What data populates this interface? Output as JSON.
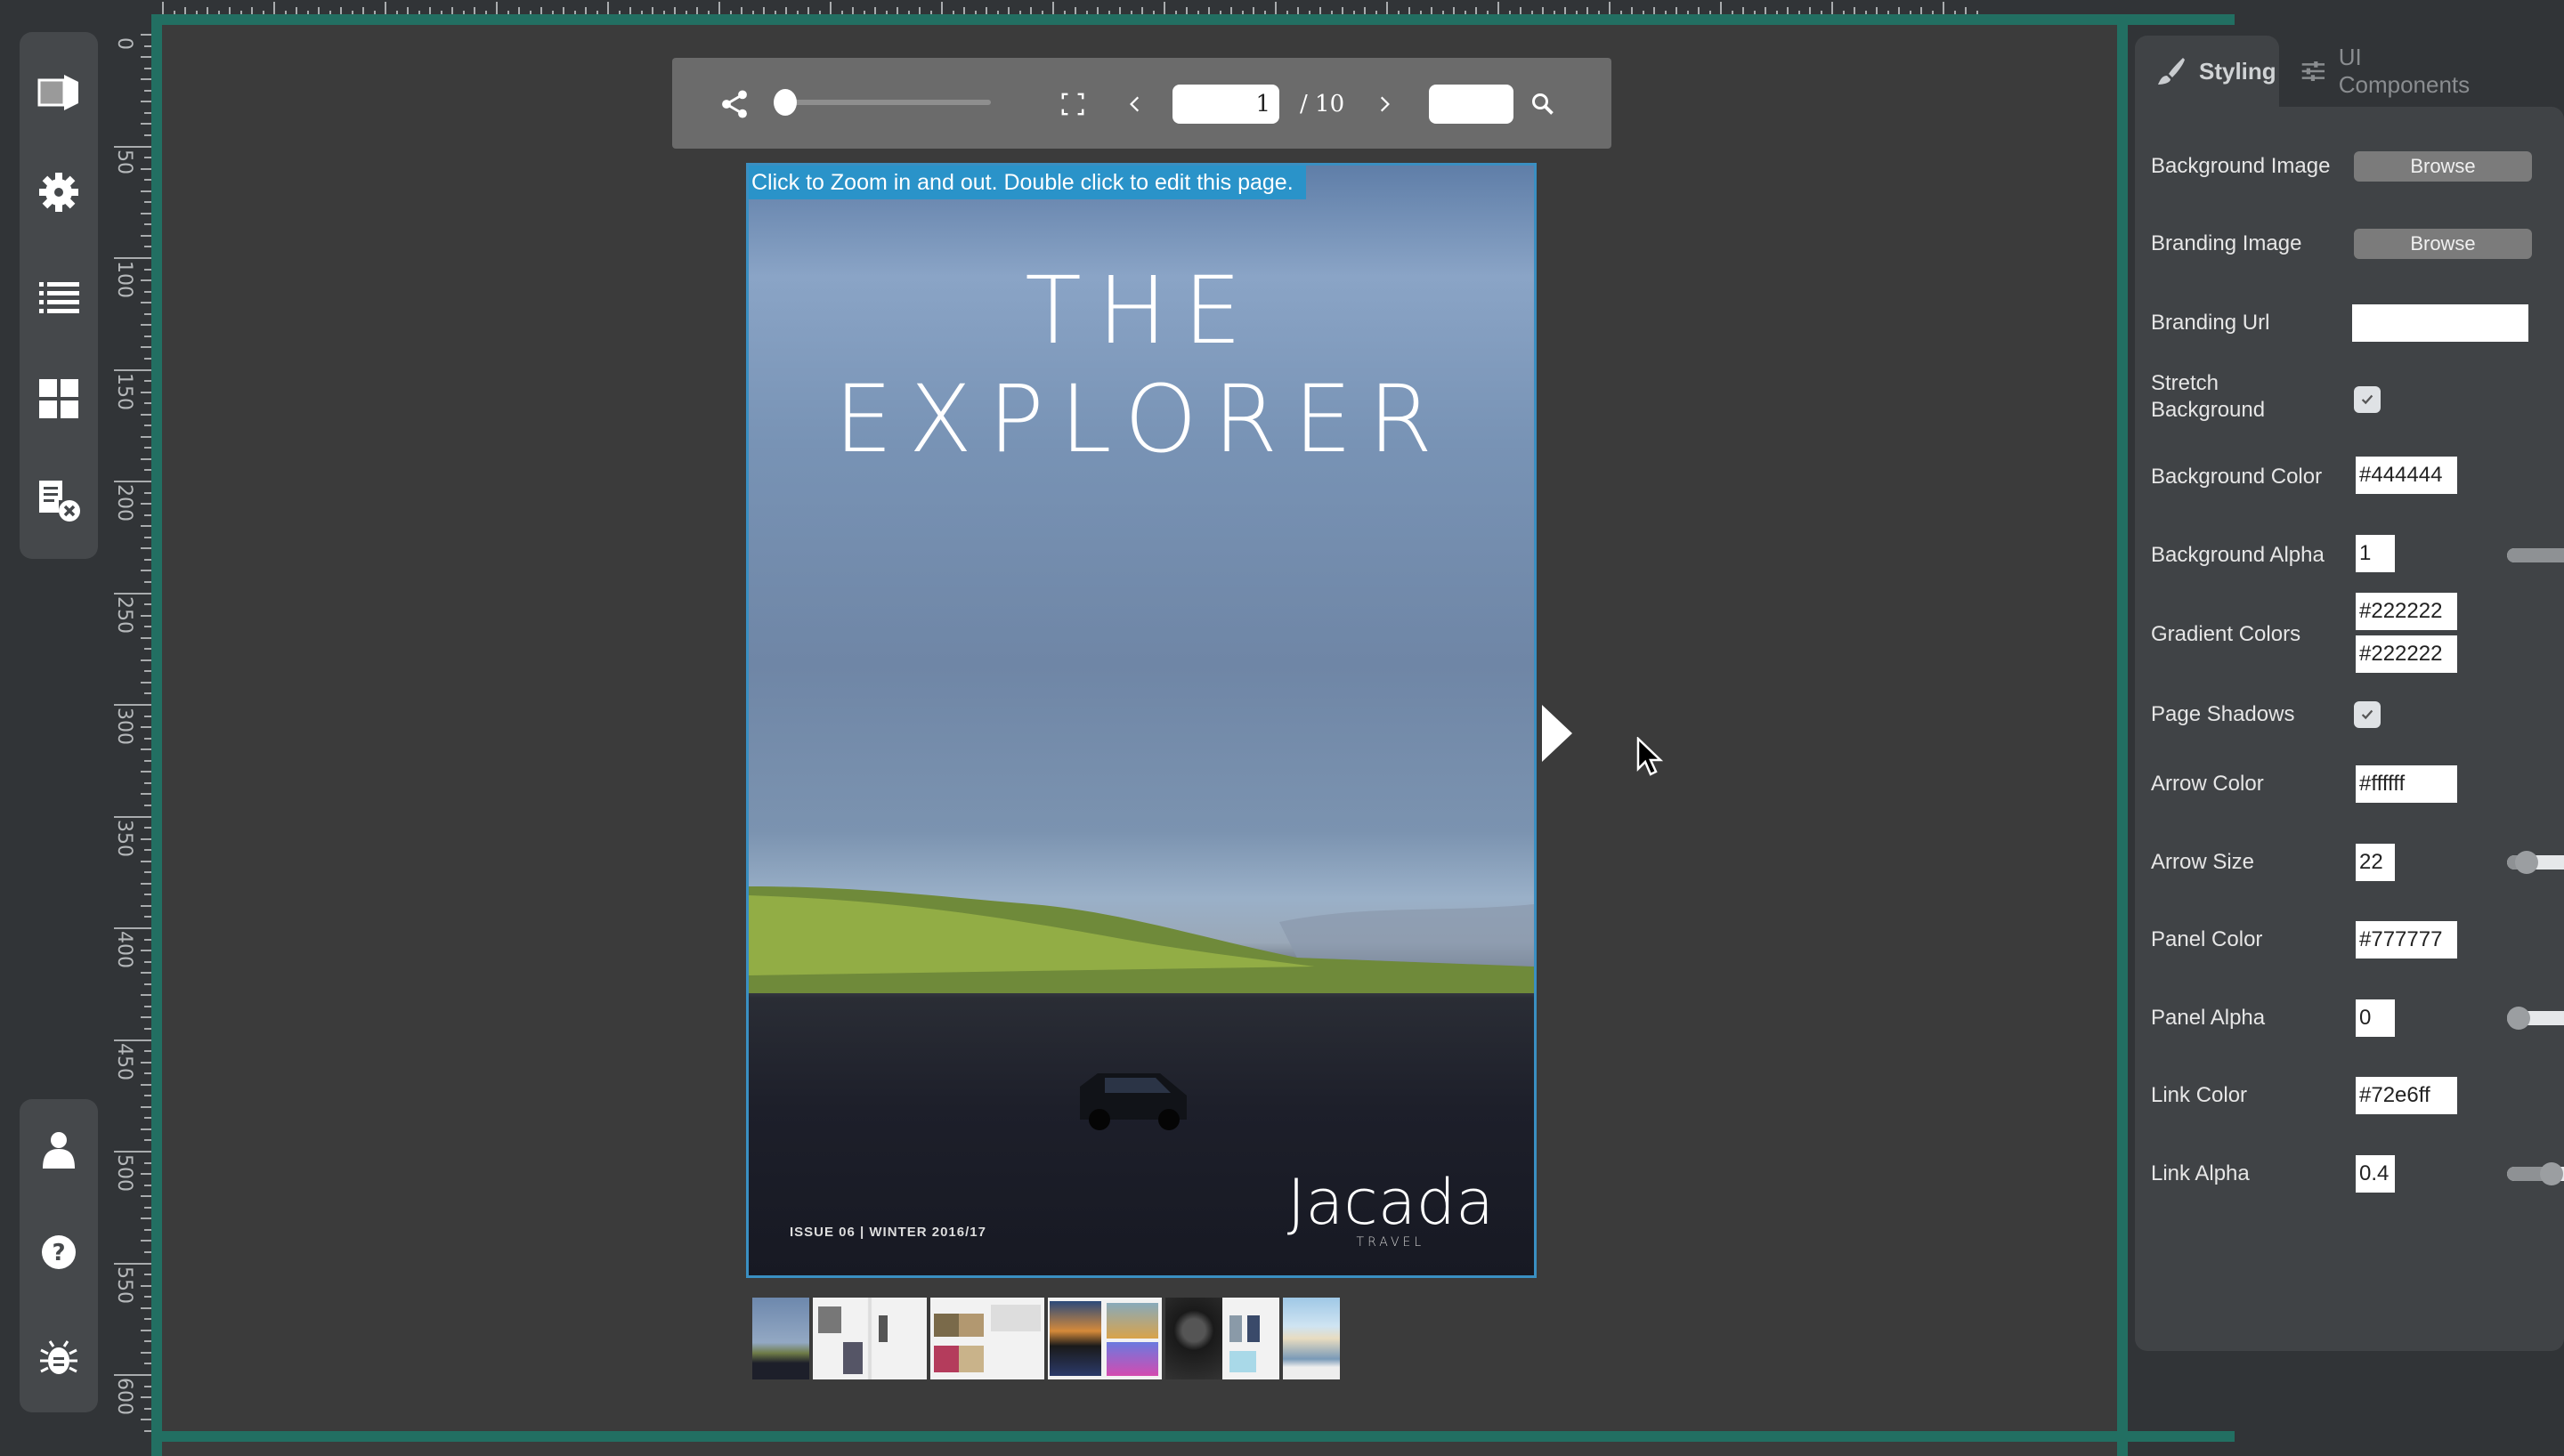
{
  "left_toolbar": {
    "top_icons": [
      "flipbook-icon",
      "settings-gear-icon",
      "list-icon",
      "grid-icon",
      "remove-page-icon"
    ],
    "bottom_icons": [
      "user-icon",
      "help-icon",
      "bug-icon"
    ]
  },
  "ruler": {
    "vertical_labels": [
      "0",
      "50",
      "100",
      "150",
      "200",
      "250",
      "300",
      "350",
      "400",
      "450",
      "500",
      "550",
      "600"
    ]
  },
  "viewer_toolbar": {
    "current_page": "1",
    "total_pages_label": "/ 10",
    "search_value": "",
    "zoom_level": 0.0
  },
  "page": {
    "hint": "Click to Zoom in and out. Double click to edit this page.",
    "cover_title": "THE EXPLORER",
    "issue_label": "ISSUE 06 | WINTER 2016/17",
    "brand_name": "Jacada",
    "brand_sub": "TRAVEL"
  },
  "thumbnails": [
    {
      "label": "page-1-cover"
    },
    {
      "label": "pages-2-3"
    },
    {
      "label": "pages-4-5"
    },
    {
      "label": "pages-6-7"
    },
    {
      "label": "pages-8-9"
    },
    {
      "label": "page-10"
    }
  ],
  "right_panel": {
    "tabs": [
      {
        "label": "Styling",
        "icon": "brush-icon",
        "active": true
      },
      {
        "label": "UI Components",
        "icon": "sliders-icon",
        "active": false
      }
    ],
    "fields": {
      "background_image": {
        "label": "Background Image",
        "button": "Browse"
      },
      "branding_image": {
        "label": "Branding Image",
        "button": "Browse"
      },
      "branding_url": {
        "label": "Branding Url",
        "value": ""
      },
      "stretch_background": {
        "label_line1": "Stretch",
        "label_line2": "Background",
        "checked": true
      },
      "background_color": {
        "label": "Background Color",
        "value": "#444444"
      },
      "background_alpha": {
        "label": "Background Alpha",
        "value": "1",
        "slider": 1.0
      },
      "gradient_colors": {
        "label": "Gradient Colors",
        "value1": "#222222",
        "value2": "#222222"
      },
      "page_shadows": {
        "label": "Page Shadows",
        "checked": true
      },
      "arrow_color": {
        "label": "Arrow Color",
        "value": "#ffffff"
      },
      "arrow_size": {
        "label": "Arrow Size",
        "value": "22",
        "slider": 0.1
      },
      "panel_color": {
        "label": "Panel Color",
        "value": "#777777"
      },
      "panel_alpha": {
        "label": "Panel Alpha",
        "value": "0",
        "slider": 0.0
      },
      "link_color": {
        "label": "Link Color",
        "value": "#72e6ff"
      },
      "link_alpha": {
        "label": "Link Alpha",
        "value": "0.4",
        "slider": 0.4
      }
    }
  },
  "colors": {
    "canvas_border": "#226f62",
    "hint_bg": "#2a93c9",
    "panel_bg": "#404346",
    "app_bg": "#313437"
  }
}
